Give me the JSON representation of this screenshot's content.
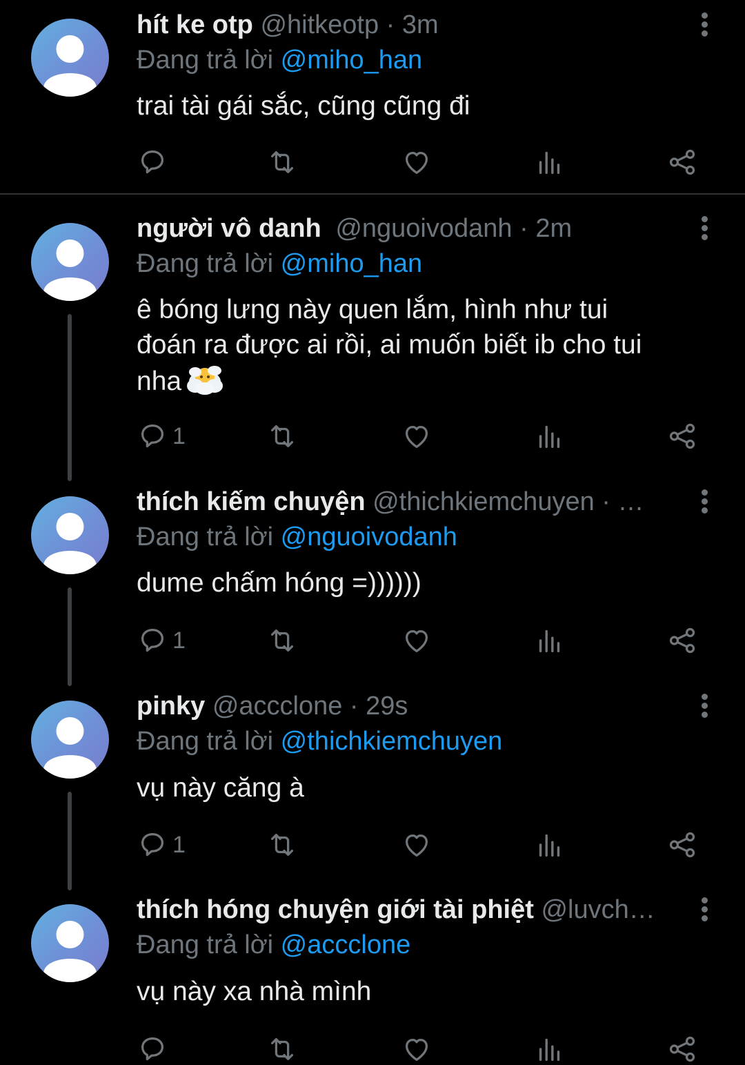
{
  "colors": {
    "background": "#000000",
    "text": "#e7e9ea",
    "muted": "#6e767d",
    "mention": "#1d9bf0",
    "thread_line": "#3e4144"
  },
  "reply_prefix": "Đang trả lời",
  "icons": [
    "reply-icon",
    "retweet-icon",
    "like-icon",
    "views-icon",
    "share-icon",
    "more-icon",
    "avatar-placeholder-icon"
  ],
  "tweets": [
    {
      "name": "hít ke otp",
      "handle": "@hitkeotp",
      "separator": " · ",
      "time": "3m",
      "reply_to": "@miho_han",
      "text": "trai tài gái sắc, cũng cũng đi",
      "reply_count": ""
    },
    {
      "name": "người vô danh",
      "handle": "@nguoivodanh",
      "separator": " · ",
      "time": "2m",
      "reply_to": "@miho_han",
      "text_lines": [
        "ê bóng lưng này quen lắm, hình như tui",
        "đoán ra được ai rồi, ai muốn biết ib cho tui",
        "nha"
      ],
      "reply_count": "1"
    },
    {
      "name": "thích kiếm chuyện",
      "handle": "@thichkiemchuyen",
      "separator": " · ",
      "time": "…",
      "reply_to": "@nguoivodanh",
      "text": "dume chấm hóng =))))))",
      "reply_count": "1"
    },
    {
      "name": "pinky",
      "handle": "@accclone",
      "separator": " · ",
      "time": "29s",
      "reply_to": "@thichkiemchuyen",
      "text": "vụ này căng à",
      "reply_count": "1"
    },
    {
      "name": "thích hóng chuyện giới tài phiệt",
      "handle": "@luvch…",
      "separator": "",
      "time": "",
      "reply_to": "@accclone",
      "text": "vụ này xa nhà mình",
      "reply_count": ""
    }
  ]
}
